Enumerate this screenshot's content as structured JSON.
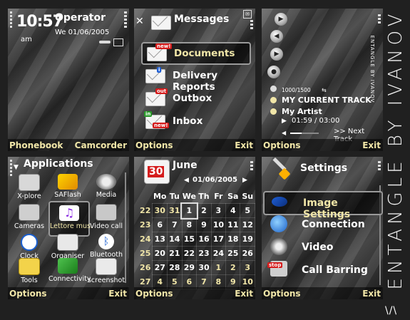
{
  "standby": {
    "time": "10:57",
    "ampm": "am",
    "operator": "Operator",
    "date": "We 01/06/2005",
    "left_soft": "Phonebook",
    "right_soft": "Camcorder"
  },
  "messages": {
    "title": "Messages",
    "items": [
      {
        "label": "Documents",
        "badge": "new!"
      },
      {
        "label": "Delivery Reports",
        "badge": ""
      },
      {
        "label": "Outbox",
        "badge": "out"
      },
      {
        "label": "Inbox",
        "badge": "new!"
      }
    ],
    "left_soft": "Options",
    "right_soft": "Exit"
  },
  "player": {
    "count": "1000/1500",
    "track": "MY CURRENT TRACK",
    "artist": "My Artist",
    "time": "01:59 / 03:00",
    "next": ">> Next Track",
    "buttons": [
      "▶",
      "◀",
      "▶",
      "●"
    ],
    "side_text": "ENTANGLE BY IVANOV",
    "progress": 0.4,
    "left_soft": "Options",
    "right_soft": "Exit"
  },
  "applications": {
    "title": "Applications",
    "apps": [
      "X-plore",
      "SAFlash",
      "Media",
      "Cameras",
      "Lettore mus.",
      "Video call",
      "Clock",
      "Organiser",
      "Bluetooth",
      "Tools",
      "Connectivity",
      "screenshot"
    ],
    "left_soft": "Options",
    "right_soft": "Exit"
  },
  "calendar": {
    "month": "June",
    "day_badge": "30",
    "date": "01/06/2005",
    "headers": [
      "Mo",
      "Tu",
      "We",
      "Th",
      "Fr",
      "Sa",
      "Su"
    ],
    "rows": [
      [
        "22",
        "30",
        "31",
        "1",
        "2",
        "3",
        "4",
        "5"
      ],
      [
        "23",
        "6",
        "7",
        "8",
        "9",
        "10",
        "11",
        "12"
      ],
      [
        "24",
        "13",
        "14",
        "15",
        "16",
        "17",
        "18",
        "19"
      ],
      [
        "25",
        "20",
        "21",
        "22",
        "23",
        "24",
        "25",
        "26"
      ],
      [
        "26",
        "27",
        "28",
        "29",
        "30",
        "1",
        "2",
        "3"
      ],
      [
        "27",
        "4",
        "5",
        "6",
        "7",
        "8",
        "9",
        "10"
      ]
    ],
    "left_soft": "Options",
    "right_soft": "Exit"
  },
  "settings": {
    "title": "Settings",
    "items": [
      {
        "label": "Image Settings"
      },
      {
        "label": "Connection"
      },
      {
        "label": "Video"
      },
      {
        "label": "Call Barring",
        "badge": "stop"
      }
    ],
    "left_soft": "Options",
    "right_soft": "Exit"
  },
  "brand": {
    "vertical": "ENTANGLE BY IVANOV",
    "footer": "\\/\\"
  },
  "colors": {
    "softkey": "#f1e6a8",
    "badge_red": "#d51c1c",
    "background": "#202020"
  }
}
